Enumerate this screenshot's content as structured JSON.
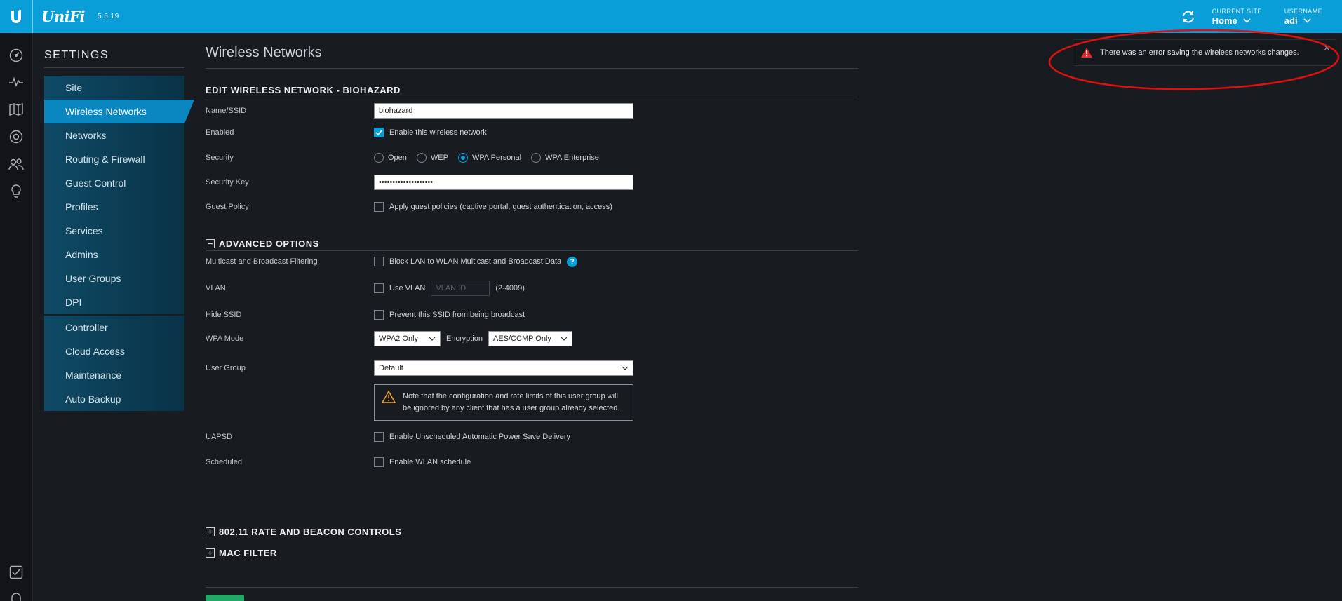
{
  "topbar": {
    "brand": "UniFi",
    "version": "5.5.19",
    "current_site_label": "CURRENT SITE",
    "current_site": "Home",
    "username_label": "USERNAME",
    "username": "adi"
  },
  "rail": {
    "icons": [
      "dashboard-icon",
      "statistics-icon",
      "map-icon",
      "devices-icon",
      "clients-icon",
      "insights-icon",
      "alerts-icon",
      "events-icon"
    ]
  },
  "nav": {
    "title": "SETTINGS",
    "items": [
      {
        "label": "Site"
      },
      {
        "label": "Wireless Networks",
        "active": true
      },
      {
        "label": "Networks"
      },
      {
        "label": "Routing & Firewall"
      },
      {
        "label": "Guest Control"
      },
      {
        "label": "Profiles"
      },
      {
        "label": "Services"
      },
      {
        "label": "Admins"
      },
      {
        "label": "User Groups"
      },
      {
        "label": "DPI"
      }
    ],
    "items2": [
      {
        "label": "Controller"
      },
      {
        "label": "Cloud Access"
      },
      {
        "label": "Maintenance"
      },
      {
        "label": "Auto Backup"
      }
    ]
  },
  "main": {
    "page_title": "Wireless Networks",
    "section_title": "EDIT WIRELESS NETWORK - BIOHAZARD",
    "name_label": "Name/SSID",
    "name_value": "biohazard",
    "enabled_label": "Enabled",
    "enabled_text": "Enable this wireless network",
    "security_label": "Security",
    "security_options": [
      "Open",
      "WEP",
      "WPA Personal",
      "WPA Enterprise"
    ],
    "security_selected": "WPA Personal",
    "key_label": "Security Key",
    "key_value": "••••••••••••••••••••",
    "guest_label": "Guest Policy",
    "guest_text": "Apply guest policies (captive portal, guest authentication, access)",
    "advanced_title": "ADVANCED OPTIONS",
    "multicast_label": "Multicast and Broadcast Filtering",
    "multicast_text": "Block LAN to WLAN Multicast and Broadcast Data",
    "vlan_label": "VLAN",
    "vlan_text": "Use VLAN",
    "vlan_placeholder": "VLAN ID",
    "vlan_range": "(2-4009)",
    "hide_label": "Hide SSID",
    "hide_text": "Prevent this SSID from being broadcast",
    "wpa_label": "WPA Mode",
    "wpa_value": "WPA2 Only",
    "encryption_label": "Encryption",
    "encryption_value": "AES/CCMP Only",
    "usergroup_label": "User Group",
    "usergroup_value": "Default",
    "usergroup_note": "Note that the configuration and rate limits of this user group will be ignored by any client that has a user group already selected.",
    "uapsd_label": "UAPSD",
    "uapsd_text": "Enable Unscheduled Automatic Power Save Delivery",
    "scheduled_label": "Scheduled",
    "scheduled_text": "Enable WLAN schedule",
    "rate_title": "802.11 RATE AND BEACON CONTROLS",
    "mac_title": "MAC FILTER"
  },
  "toast": {
    "message": "There was an error saving the wireless networks changes."
  },
  "colors": {
    "topbar": "#0a9ed9",
    "accent": "#0a9ed9",
    "error": "#e02b2b",
    "warning": "#f0a030",
    "annotation": "#e01010"
  }
}
